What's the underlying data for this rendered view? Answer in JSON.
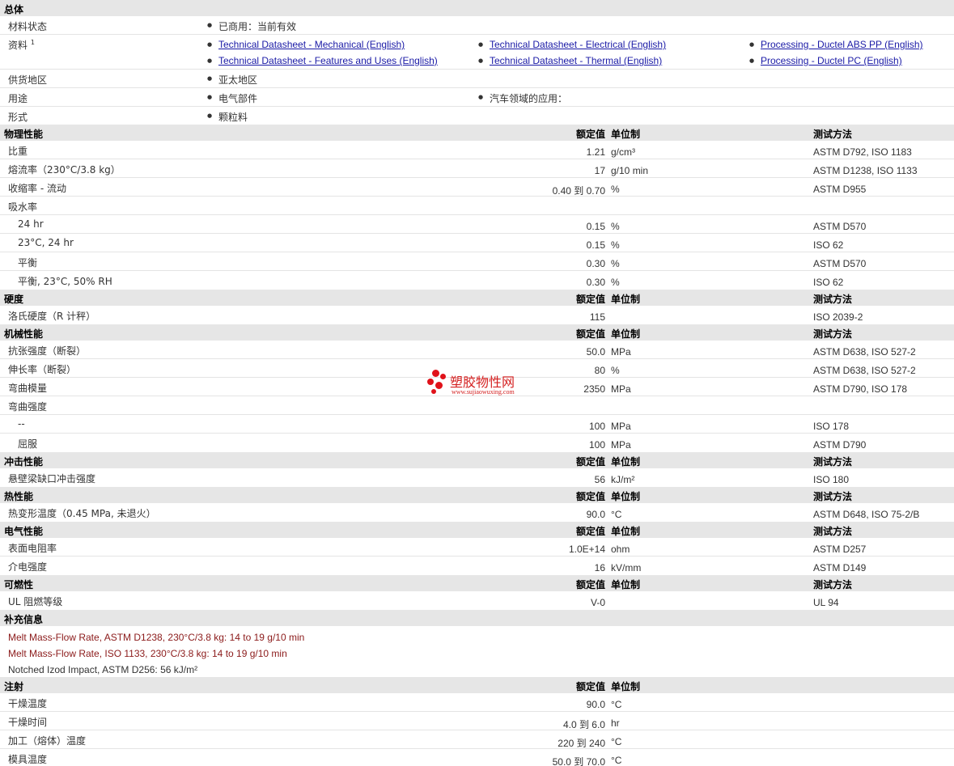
{
  "general": {
    "title": "总体",
    "status_label": "材料状态",
    "status_value": "已商用：当前有效",
    "docs_label": "资料",
    "docs_sup": "1",
    "docs": [
      "Technical Datasheet - Mechanical (English)",
      "Technical Datasheet - Features and Uses (English)",
      "Technical Datasheet - Electrical (English)",
      "Technical Datasheet - Thermal (English)",
      "Processing - Ductel ABS PP (English)",
      "Processing - Ductel PC (English)"
    ],
    "supply_label": "供货地区",
    "supply_value": "亚太地区",
    "use_label": "用途",
    "use_values": [
      "电气部件",
      "汽车领域的应用："
    ],
    "form_label": "形式",
    "form_value": "颗粒料"
  },
  "columns": {
    "value": "额定值",
    "unit": "单位制",
    "method": "测试方法"
  },
  "physical": {
    "title": "物理性能",
    "rows": [
      {
        "label": "比重",
        "value": "1.21",
        "unit": "g/cm³",
        "method": "ASTM D792, ISO 1183"
      },
      {
        "label": "熔流率（230°C/3.8 kg）",
        "value": "17",
        "unit": "g/10 min",
        "method": "ASTM D1238, ISO 1133"
      },
      {
        "label": "收缩率 - 流动",
        "value": "0.40 到  0.70",
        "unit": "%",
        "method": "ASTM D955"
      },
      {
        "label": "吸水率",
        "value": "",
        "unit": "",
        "method": ""
      },
      {
        "label": "24 hr",
        "value": "0.15",
        "unit": "%",
        "method": "ASTM D570"
      },
      {
        "label": "23°C, 24 hr",
        "value": "0.15",
        "unit": "%",
        "method": "ISO 62"
      },
      {
        "label": "平衡",
        "value": "0.30",
        "unit": "%",
        "method": "ASTM D570"
      },
      {
        "label": "平衡, 23°C, 50% RH",
        "value": "0.30",
        "unit": "%",
        "method": "ISO 62"
      }
    ]
  },
  "hardness": {
    "title": "硬度",
    "rows": [
      {
        "label": "洛氏硬度（R 计秤）",
        "value": "115",
        "unit": "",
        "method": "ISO 2039-2"
      }
    ]
  },
  "mechanical": {
    "title": "机械性能",
    "rows": [
      {
        "label": "抗张强度（断裂）",
        "value": "50.0",
        "unit": "MPa",
        "method": "ASTM D638, ISO 527-2"
      },
      {
        "label": "伸长率（断裂）",
        "value": "80",
        "unit": "%",
        "method": "ASTM D638, ISO 527-2"
      },
      {
        "label": "弯曲模量",
        "value": "2350",
        "unit": "MPa",
        "method": "ASTM D790, ISO 178"
      },
      {
        "label": "弯曲强度",
        "value": "",
        "unit": "",
        "method": ""
      },
      {
        "label": "--",
        "value": "100",
        "unit": "MPa",
        "method": "ISO 178"
      },
      {
        "label": "屈服",
        "value": "100",
        "unit": "MPa",
        "method": "ASTM D790"
      }
    ]
  },
  "impact": {
    "title": "冲击性能",
    "rows": [
      {
        "label": "悬壁梁缺口冲击强度",
        "value": "56",
        "unit": "kJ/m²",
        "method": "ISO 180"
      }
    ]
  },
  "thermal": {
    "title": "热性能",
    "rows": [
      {
        "label": "热变形温度（0.45 MPa, 未退火）",
        "value": "90.0",
        "unit": "°C",
        "method": "ASTM D648, ISO 75-2/B"
      }
    ]
  },
  "electrical": {
    "title": "电气性能",
    "rows": [
      {
        "label": "表面电阻率",
        "value": "1.0E+14",
        "unit": "ohm",
        "method": "ASTM D257"
      },
      {
        "label": "介电强度",
        "value": "16",
        "unit": "kV/mm",
        "method": "ASTM D149"
      }
    ]
  },
  "flammability": {
    "title": "可燃性",
    "rows": [
      {
        "label": "UL 阻燃等级",
        "value": "V-0",
        "unit": "",
        "method": "UL 94"
      }
    ]
  },
  "supplementary": {
    "title": "补充信息",
    "lines": [
      "Melt Mass-Flow Rate, ASTM D1238, 230°C/3.8 kg: 14 to 19 g/10 min",
      "Melt Mass-Flow Rate, ISO 1133, 230°C/3.8 kg: 14 to 19 g/10 min",
      "Notched Izod Impact, ASTM D256: 56 kJ/m²"
    ]
  },
  "injection": {
    "title": "注射",
    "rows": [
      {
        "label": "干燥温度",
        "value": "90.0",
        "unit": "°C"
      },
      {
        "label": "干燥时间",
        "value": "4.0 到  6.0",
        "unit": "hr"
      },
      {
        "label": "加工（熔体）温度",
        "value": "220 到  240",
        "unit": "°C"
      },
      {
        "label": "模具温度",
        "value": "50.0 到  70.0",
        "unit": "°C"
      }
    ]
  },
  "watermark": {
    "name": "塑胶物性网",
    "url": "www.sujiaowuxing.com",
    "color": "#e0121a"
  }
}
